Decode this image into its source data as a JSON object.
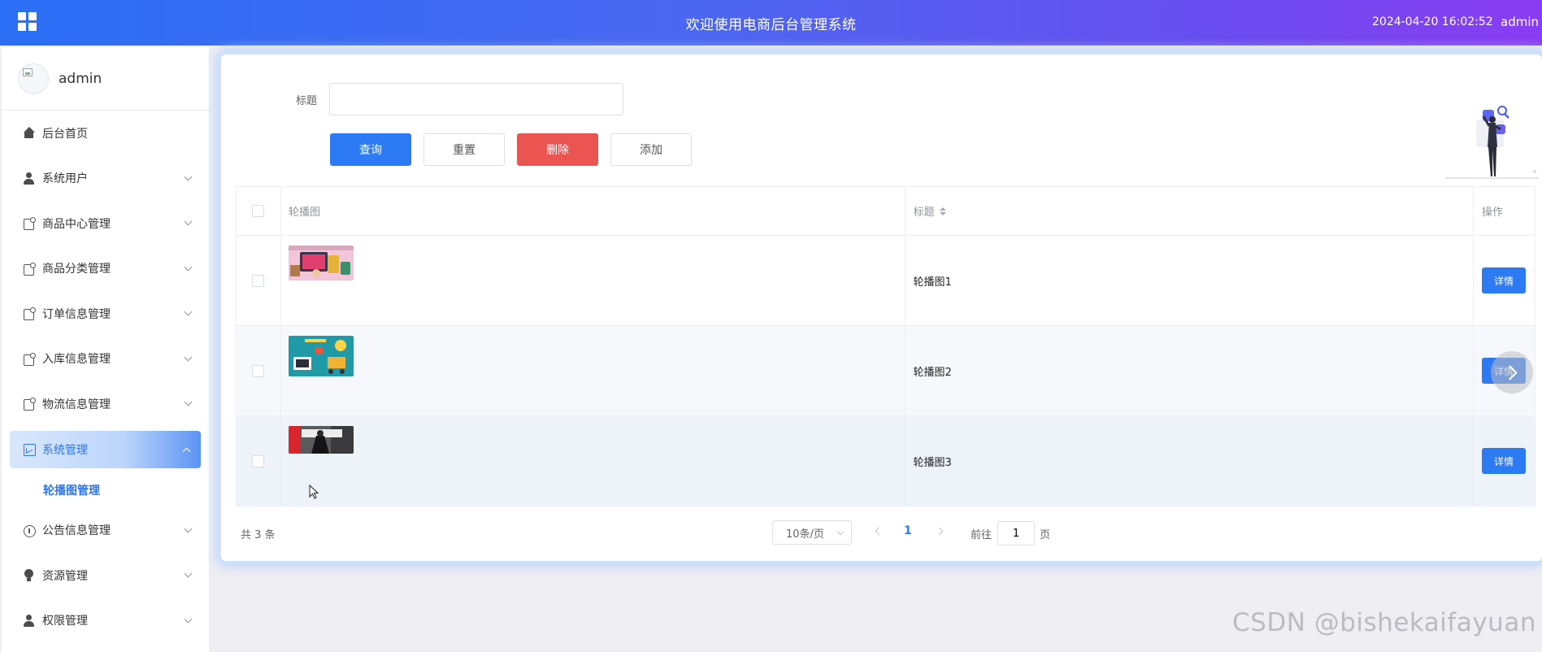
{
  "header": {
    "title": "欢迎使用电商后台管理系统",
    "datetime": "2024-04-20 16:02:52",
    "user": "admin"
  },
  "sidebar": {
    "username": "admin",
    "items": [
      {
        "label": "后台首页",
        "icon": "home-icon"
      },
      {
        "label": "系统用户",
        "icon": "user-icon"
      },
      {
        "label": "商品中心管理",
        "icon": "document-icon"
      },
      {
        "label": "商品分类管理",
        "icon": "document-icon"
      },
      {
        "label": "订单信息管理",
        "icon": "document-icon"
      },
      {
        "label": "入库信息管理",
        "icon": "document-icon"
      },
      {
        "label": "物流信息管理",
        "icon": "document-icon"
      },
      {
        "label": "系统管理",
        "icon": "chart-icon"
      },
      {
        "label": "公告信息管理",
        "icon": "info-icon"
      },
      {
        "label": "资源管理",
        "icon": "bulb-icon"
      },
      {
        "label": "权限管理",
        "icon": "user-icon"
      }
    ],
    "submenu": {
      "label": "轮播图管理"
    }
  },
  "search": {
    "label": "标题",
    "value": "",
    "placeholder": ""
  },
  "toolbar": {
    "query": "查询",
    "reset": "重置",
    "delete": "删除",
    "add": "添加"
  },
  "table": {
    "headers": {
      "image": "轮播图",
      "title": "标题",
      "actions": "操作"
    },
    "rows": [
      {
        "title": "轮播图1",
        "action": "详情"
      },
      {
        "title": "轮播图2",
        "action": "详情"
      },
      {
        "title": "轮播图3",
        "action": "详情"
      }
    ]
  },
  "pagination": {
    "total": "共 3 条",
    "page_size": "10条/页",
    "current_page": "1",
    "goto_label": "前往",
    "goto_value": "1",
    "goto_suffix": "页"
  },
  "watermark": "CSDN @bishekaifayuan",
  "colors": {
    "primary": "#2d7af5",
    "danger": "#ea5451",
    "header_start": "#2b6ef6",
    "header_end": "#8a3cf2"
  }
}
